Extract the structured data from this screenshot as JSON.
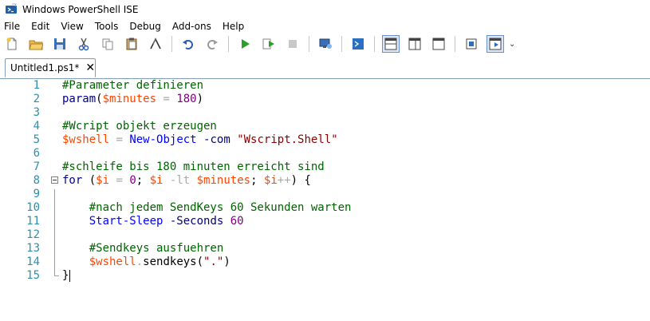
{
  "window": {
    "title": "Windows PowerShell ISE"
  },
  "menu": [
    "File",
    "Edit",
    "View",
    "Tools",
    "Debug",
    "Add-ons",
    "Help"
  ],
  "toolbar": {
    "icons": [
      "new-file-icon",
      "open-folder-icon",
      "save-icon",
      "cut-icon",
      "copy-icon",
      "paste-icon",
      "clear-console-icon",
      "undo-icon",
      "redo-icon",
      "run-script-icon",
      "run-selection-icon",
      "stop-icon",
      "new-remote-tab-icon",
      "start-powershell-icon",
      "script-pane-top-icon",
      "script-pane-right-icon",
      "script-pane-maximized-icon",
      "show-commands-addon-icon",
      "show-command-window-icon"
    ],
    "overflow": "⌄"
  },
  "tab": {
    "label": "Untitled1.ps1*",
    "close": "✕"
  },
  "colors": {
    "comment": "#006400",
    "keyword": "#00008b",
    "variable": "#ff4500",
    "number": "#800080",
    "command": "#0000ff",
    "string": "#8b0000",
    "linenum": "#2b91af"
  },
  "code": [
    {
      "n": "1",
      "tokens": [
        {
          "t": "#Parameter definieren",
          "c": "comment"
        }
      ]
    },
    {
      "n": "2",
      "tokens": [
        {
          "t": "param",
          "c": "kw"
        },
        {
          "t": "(",
          "c": "plain"
        },
        {
          "t": "$minutes",
          "c": "var"
        },
        {
          "t": " = ",
          "c": "op"
        },
        {
          "t": "180",
          "c": "num"
        },
        {
          "t": ")",
          "c": "plain"
        }
      ]
    },
    {
      "n": "3",
      "tokens": []
    },
    {
      "n": "4",
      "tokens": [
        {
          "t": "#Wcript objekt erzeugen",
          "c": "comment"
        }
      ]
    },
    {
      "n": "5",
      "tokens": [
        {
          "t": "$wshell",
          "c": "var"
        },
        {
          "t": " = ",
          "c": "op"
        },
        {
          "t": "New-Object",
          "c": "cmd"
        },
        {
          "t": " -com ",
          "c": "param"
        },
        {
          "t": "\"Wscript.Shell\"",
          "c": "str"
        }
      ]
    },
    {
      "n": "6",
      "tokens": []
    },
    {
      "n": "7",
      "tokens": [
        {
          "t": "#schleife bis 180 minuten erreicht sind",
          "c": "comment"
        }
      ]
    },
    {
      "n": "8",
      "tokens": [
        {
          "t": "for",
          "c": "kw"
        },
        {
          "t": " (",
          "c": "plain"
        },
        {
          "t": "$i",
          "c": "var"
        },
        {
          "t": " = ",
          "c": "op"
        },
        {
          "t": "0",
          "c": "num"
        },
        {
          "t": "; ",
          "c": "plain"
        },
        {
          "t": "$i",
          "c": "var"
        },
        {
          "t": " -lt ",
          "c": "op"
        },
        {
          "t": "$minutes",
          "c": "var"
        },
        {
          "t": "; ",
          "c": "plain"
        },
        {
          "t": "$i",
          "c": "var"
        },
        {
          "t": "++",
          "c": "op"
        },
        {
          "t": ") {",
          "c": "plain"
        }
      ]
    },
    {
      "n": "9",
      "tokens": []
    },
    {
      "n": "10",
      "tokens": [
        {
          "t": "    ",
          "c": "plain"
        },
        {
          "t": "#nach jedem SendKeys 60 Sekunden warten",
          "c": "comment"
        }
      ]
    },
    {
      "n": "11",
      "tokens": [
        {
          "t": "    ",
          "c": "plain"
        },
        {
          "t": "Start-Sleep",
          "c": "cmd"
        },
        {
          "t": " -Seconds ",
          "c": "param"
        },
        {
          "t": "60",
          "c": "num"
        }
      ]
    },
    {
      "n": "12",
      "tokens": []
    },
    {
      "n": "13",
      "tokens": [
        {
          "t": "    ",
          "c": "plain"
        },
        {
          "t": "#Sendkeys ausfuehren",
          "c": "comment"
        }
      ]
    },
    {
      "n": "14",
      "tokens": [
        {
          "t": "    ",
          "c": "plain"
        },
        {
          "t": "$wshell",
          "c": "var"
        },
        {
          "t": ".",
          "c": "op"
        },
        {
          "t": "sendkeys",
          "c": "member"
        },
        {
          "t": "(",
          "c": "plain"
        },
        {
          "t": "\".\"",
          "c": "str"
        },
        {
          "t": ")",
          "c": "plain"
        }
      ]
    },
    {
      "n": "15",
      "tokens": [
        {
          "t": "}",
          "c": "plain"
        }
      ]
    }
  ]
}
